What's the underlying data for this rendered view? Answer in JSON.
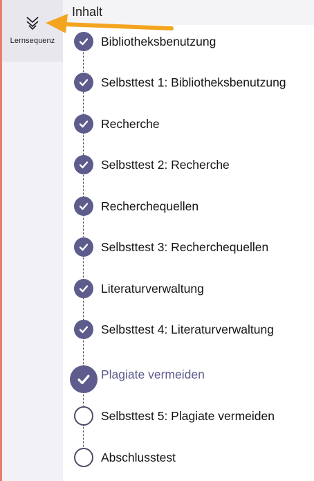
{
  "sidebar": {
    "tab_label": "Lernsequenz",
    "tab_icon": "double-chevron-down-icon"
  },
  "header": {
    "title": "Inhalt"
  },
  "colors": {
    "accent": "#5d5c8c",
    "annotation_arrow": "#f3a51f",
    "side_strip": "#e87f6e"
  },
  "items": [
    {
      "label": "Bibliotheksbenutzung",
      "status": "completed"
    },
    {
      "label": "Selbsttest 1: Bibliotheksbenutzung",
      "status": "completed"
    },
    {
      "label": "Recherche",
      "status": "completed"
    },
    {
      "label": "Selbsttest 2: Recherche",
      "status": "completed"
    },
    {
      "label": "Recherchequellen",
      "status": "completed"
    },
    {
      "label": "Selbsttest 3: Recherchequellen",
      "status": "completed"
    },
    {
      "label": "Literaturverwaltung",
      "status": "completed"
    },
    {
      "label": "Selbsttest 4: Literaturverwaltung",
      "status": "completed"
    },
    {
      "label": "Plagiate vermeiden",
      "status": "current-completed"
    },
    {
      "label": "Selbsttest 5: Plagiate vermeiden",
      "status": "not-started"
    },
    {
      "label": "Abschlusstest",
      "status": "not-started"
    }
  ]
}
